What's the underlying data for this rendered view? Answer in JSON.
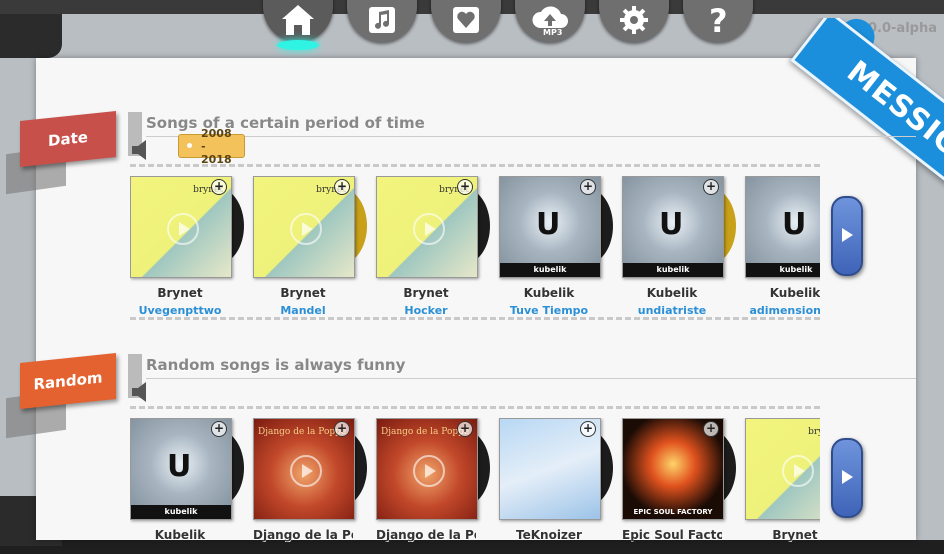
{
  "app": {
    "version": "0.0-alpha",
    "logo_text": "MESSIC"
  },
  "nav": [
    {
      "name": "home",
      "active": true
    },
    {
      "name": "music",
      "active": false
    },
    {
      "name": "favorites",
      "active": false
    },
    {
      "name": "upload",
      "label": "MP3",
      "active": false
    },
    {
      "name": "settings",
      "active": false
    },
    {
      "name": "help",
      "active": false
    }
  ],
  "sections": {
    "date": {
      "label": "Date",
      "title": "Songs of a certain period of time",
      "tag": "2008 - 2018",
      "items": [
        {
          "artist": "Brynet",
          "title": "Uvegenpttwo",
          "cover": "brynet"
        },
        {
          "artist": "Brynet",
          "title": "Mandel",
          "cover": "brynet"
        },
        {
          "artist": "Brynet",
          "title": "Hocker",
          "cover": "brynet"
        },
        {
          "artist": "Kubelik",
          "title": "Tuve Tiempo",
          "cover": "kubelik"
        },
        {
          "artist": "Kubelik",
          "title": "undiatriste",
          "cover": "kubelik"
        },
        {
          "artist": "Kubelik",
          "title": "adimensional -",
          "cover": "kubelik"
        }
      ]
    },
    "random": {
      "label": "Random",
      "title": "Random songs is always funny",
      "items": [
        {
          "artist": "Kubelik",
          "title": "",
          "cover": "kubelik"
        },
        {
          "artist": "Django de la Popp",
          "title": "",
          "cover": "django"
        },
        {
          "artist": "Django de la Popp",
          "title": "",
          "cover": "django"
        },
        {
          "artist": "TeKnoizer",
          "title": "",
          "cover": "tek"
        },
        {
          "artist": "Epic Soul Factory",
          "title": "",
          "cover": "epic"
        },
        {
          "artist": "Brynet",
          "title": "",
          "cover": "brynet"
        }
      ]
    }
  },
  "cover_text": {
    "brynet": "brynet",
    "kubelik": "kubelik",
    "django": "Django de la Poppe",
    "epic": "EPIC SOUL FACTORY"
  },
  "colors": {
    "accent": "#1c8fdc",
    "title_link": "#2a8fd6",
    "date_label": "#c8504a",
    "random_label": "#e4622f",
    "nav_glow": "#2ff4e4"
  }
}
